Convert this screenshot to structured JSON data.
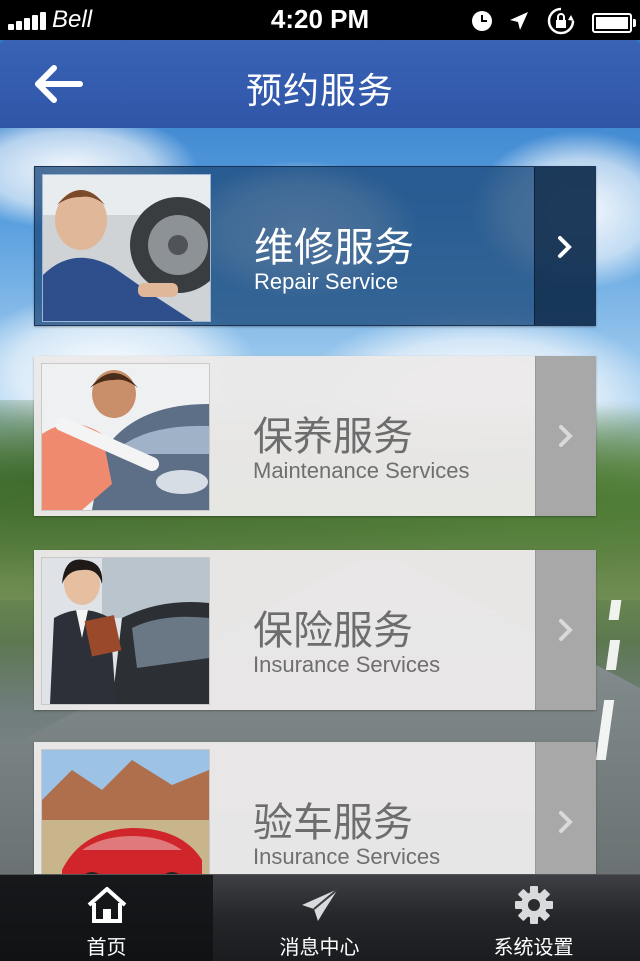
{
  "status_bar": {
    "carrier": "Bell",
    "time": "4:20 PM",
    "icons": [
      "signal-icon",
      "clock-icon",
      "location-icon",
      "rotation-lock-icon",
      "battery-icon"
    ]
  },
  "nav": {
    "title": "预约服务",
    "back_icon": "back-arrow-icon"
  },
  "services": [
    {
      "title": "维修服务",
      "subtitle": "Repair Service",
      "active": true,
      "thumb": "mechanic-wheel-photo"
    },
    {
      "title": "保养服务",
      "subtitle": "Maintenance Services",
      "active": false,
      "thumb": "woman-car-hood-photo"
    },
    {
      "title": "保险服务",
      "subtitle": "Insurance Services",
      "active": false,
      "thumb": "businesswoman-car-photo"
    },
    {
      "title": "验车服务",
      "subtitle": "Insurance Services",
      "active": false,
      "thumb": "red-convertible-photo"
    }
  ],
  "tabs": [
    {
      "label": "首页",
      "icon": "home-icon",
      "active": true
    },
    {
      "label": "消息中心",
      "icon": "paper-plane-icon",
      "active": false
    },
    {
      "label": "系统设置",
      "icon": "gear-icon",
      "active": false
    }
  ],
  "colors": {
    "nav_blue": "#2f55a7",
    "active_card": "#1e4b7d",
    "card_gray": "#ebe9e9",
    "arrow_panel": "#a9a8a8",
    "tab_bar": "#24262a"
  }
}
